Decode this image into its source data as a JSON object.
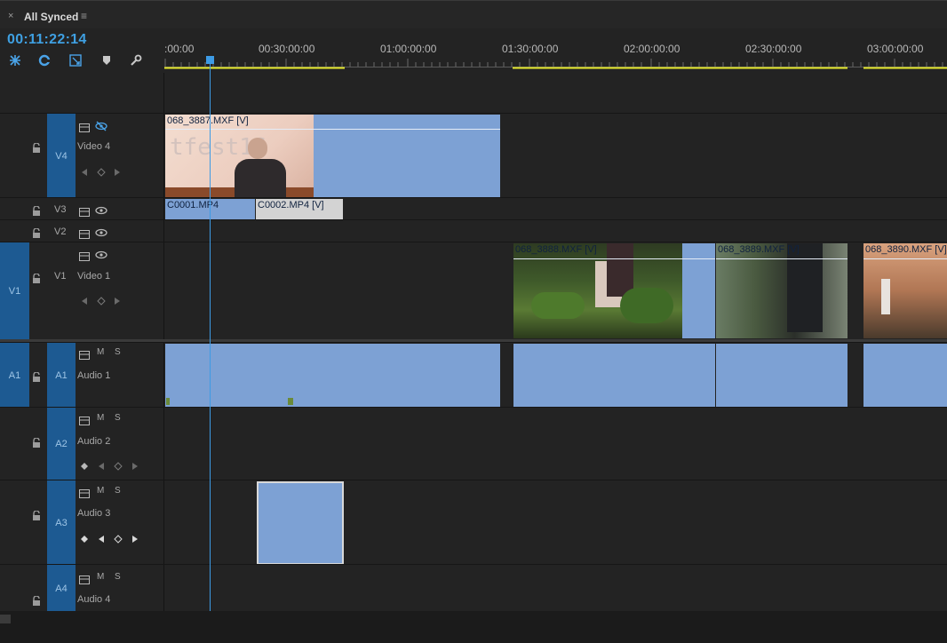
{
  "panel": {
    "close": "×",
    "title": "All Synced",
    "menu": "≡"
  },
  "timecode": "00:11:22:14",
  "tools": [
    "snap-icon",
    "linked-selection-icon",
    "add-marker-type-icon",
    "marker-icon",
    "wrench-icon"
  ],
  "ruler": {
    "ticks": [
      ":00:00",
      "00:30:00:00",
      "01:00:00:00",
      "01:30:00:00",
      "02:00:00:00",
      "02:30:00:00",
      "03:00:00:00"
    ]
  },
  "tracks": {
    "v4": {
      "code": "V4",
      "name": "Video 4"
    },
    "v3": {
      "code": "V3"
    },
    "v2": {
      "code": "V2"
    },
    "v1": {
      "src": "V1",
      "code": "V1",
      "name": "Video 1"
    },
    "a1": {
      "src": "A1",
      "code": "A1",
      "name": "Audio 1",
      "m": "M",
      "s": "S"
    },
    "a2": {
      "code": "A2",
      "name": "Audio 2",
      "m": "M",
      "s": "S"
    },
    "a3": {
      "code": "A3",
      "name": "Audio 3",
      "m": "M",
      "s": "S"
    },
    "a4": {
      "code": "A4",
      "name": "Audio 4",
      "m": "M",
      "s": "S"
    }
  },
  "clips": {
    "v4_1": "068_3887.MXF [V]",
    "v3_1": "C0001.MP4",
    "v3_2": "C0002.MP4 [V]",
    "v1_1": "068_3888.MXF [V]",
    "v1_2": "068_3889.MXF [V]",
    "v1_3": "068_3890.MXF [V]"
  },
  "thumb_text": "tfest16",
  "colors": {
    "accent": "#3d9be5",
    "clip": "#7da1d4",
    "target": "#1d5a92",
    "work_area": "#e5e82e"
  }
}
